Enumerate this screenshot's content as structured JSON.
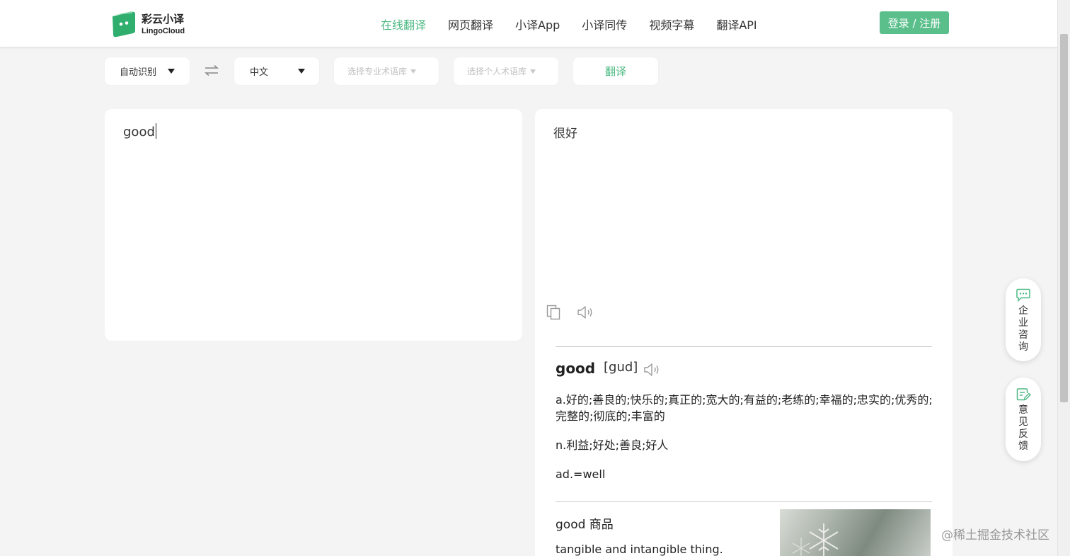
{
  "brand": {
    "name_cn": "彩云小译",
    "name_en": "LingoCloud",
    "accent": "#4cb982"
  },
  "nav": {
    "items": [
      {
        "label": "在线翻译",
        "active": true
      },
      {
        "label": "网页翻译",
        "active": false
      },
      {
        "label": "小译App",
        "active": false
      },
      {
        "label": "小译同传",
        "active": false
      },
      {
        "label": "视频字幕",
        "active": false
      },
      {
        "label": "翻译API",
        "active": false
      }
    ],
    "login_label": "登录 / 注册"
  },
  "toolbar": {
    "source_lang": "自动识别",
    "target_lang": "中文",
    "pro_glossary_placeholder": "选择专业术语库",
    "personal_glossary_placeholder": "选择个人术语库",
    "translate_label": "翻译"
  },
  "source": {
    "text": "good"
  },
  "target": {
    "text": "很好",
    "copy_icon": "copy-icon",
    "speaker_icon": "speaker-icon"
  },
  "dictionary": {
    "word": "good",
    "phonetic": "[gud]",
    "definitions": [
      "a.好的;善良的;快乐的;真正的;宽大的;有益的;老练的;幸福的;忠实的;优秀的;完整的;彻底的;丰富的",
      "n.利益;好处;善良;好人",
      "ad.=well"
    ]
  },
  "example": {
    "title": "good 商品",
    "body": "tangible and intangible thing."
  },
  "side_buttons": {
    "consult_label": "企业咨询",
    "feedback_label": "意见反馈"
  },
  "watermark": "@稀土掘金技术社区"
}
